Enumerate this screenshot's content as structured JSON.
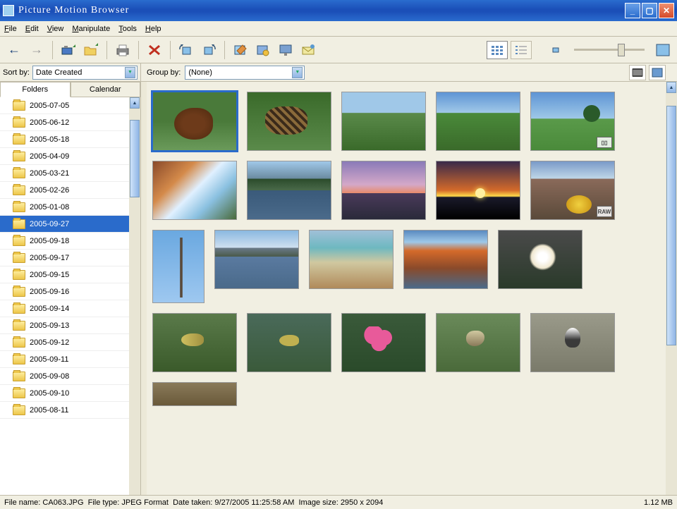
{
  "window": {
    "title": "Picture Motion Browser"
  },
  "menu": {
    "file": "File",
    "edit": "Edit",
    "view": "View",
    "manipulate": "Manipulate",
    "tools": "Tools",
    "help": "Help"
  },
  "sort": {
    "label": "Sort by:",
    "value": "Date Created"
  },
  "group": {
    "label": "Group by:",
    "value": "(None)"
  },
  "tabs": {
    "folders": "Folders",
    "calendar": "Calendar"
  },
  "folders": [
    "2005-07-05",
    "2005-06-12",
    "2005-05-18",
    "2005-04-09",
    "2005-03-21",
    "2005-02-26",
    "2005-01-08",
    "2005-09-27",
    "2005-09-18",
    "2005-09-17",
    "2005-09-15",
    "2005-09-16",
    "2005-09-14",
    "2005-09-13",
    "2005-09-12",
    "2005-09-11",
    "2005-09-08",
    "2005-09-10",
    "2005-08-11"
  ],
  "selected_folder_index": 7,
  "thumbnails": [
    {
      "id": "dog",
      "selected": true,
      "badge": null
    },
    {
      "id": "cat",
      "badge": null
    },
    {
      "id": "field",
      "badge": null
    },
    {
      "id": "farm",
      "badge": null
    },
    {
      "id": "tree",
      "badge": "▯▯"
    },
    {
      "id": "stream",
      "badge": null
    },
    {
      "id": "lake",
      "badge": null
    },
    {
      "id": "sunset1",
      "badge": null
    },
    {
      "id": "sunset2",
      "badge": null
    },
    {
      "id": "mountain",
      "badge": "RAW"
    },
    {
      "id": "deadtree",
      "portrait": true,
      "badge": null
    },
    {
      "id": "tetons",
      "badge": null
    },
    {
      "id": "hotspring",
      "badge": null
    },
    {
      "id": "geyser",
      "badge": null
    },
    {
      "id": "flower",
      "badge": null
    },
    {
      "id": "bird1",
      "badge": null
    },
    {
      "id": "bird2",
      "badge": null
    },
    {
      "id": "pinkflower",
      "badge": null
    },
    {
      "id": "bird3",
      "badge": null
    },
    {
      "id": "bird4",
      "badge": null
    }
  ],
  "status": {
    "filename_label": "File name:",
    "filename": "CA063.JPG",
    "filetype_label": "File type:",
    "filetype": "JPEG Format",
    "datetaken_label": "Date taken:",
    "datetaken": "9/27/2005 11:25:58 AM",
    "imagesize_label": "Image size:",
    "imagesize": "2950 x 2094",
    "filesize": "1.12 MB"
  }
}
